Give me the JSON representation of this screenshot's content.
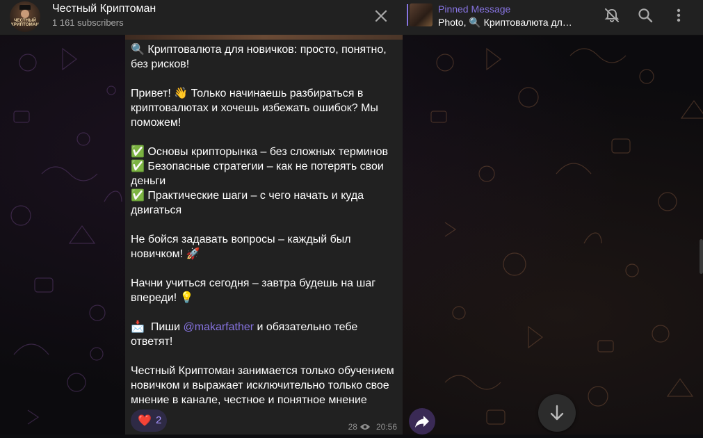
{
  "header": {
    "channel_title": "Честный Криптоман",
    "subscribers": "1 161 subscribers",
    "avatar_logo_line1": "ЧЕСТНЫЙ",
    "avatar_logo_line2": "КРИПТОМАН",
    "pinned_label": "Pinned Message",
    "pinned_preview": "Photo, 🔍  Криптовалюта дл…"
  },
  "message": {
    "lines": {
      "l1": "🔍  Криптовалюта для новичков: просто, понятно,",
      "l2": "без рисков!",
      "l3": "Привет! 👋  Только начинаешь разбираться в",
      "l4": "криптовалютах и хочешь избежать ошибок? Мы",
      "l5": "поможем!",
      "l6": "✅  Основы крипторынка – без сложных терминов",
      "l7": "✅  Безопасные стратегии – как не потерять свои",
      "l8": "деньги",
      "l9": "✅  Практические шаги – с чего начать и куда",
      "l10": "двигаться",
      "l11": "Не бойся задавать вопросы – каждый был",
      "l12": "новичком! 🚀",
      "l13": "Начни учиться сегодня – завтра будешь на шаг",
      "l14": "впереди! 💡",
      "l15_pre": "📩  Пиши ",
      "l15_link": "@makarfather",
      "l15_post": " и обязательно тебе",
      "l16": "ответят!",
      "l17": "Честный Криптоман занимается только обучением",
      "l18": "новичком и выражает исключительно только свое",
      "l19": "мнение в канале, честное и понятное мнение"
    },
    "reaction_emoji": "❤️",
    "reaction_count": "2",
    "views": "28",
    "time": "20:56"
  },
  "icons": {
    "close": "close-icon",
    "mute": "bell-off-icon",
    "search": "search-icon",
    "more": "more-vertical-icon",
    "forward": "forward-icon",
    "scroll_down": "arrow-down-icon",
    "views": "eye-icon"
  },
  "colors": {
    "accent": "#8774e1",
    "header_bg": "#212121",
    "bubble_bg": "#212121",
    "reaction_bg": "#2e2a45",
    "heart": "#e63946"
  }
}
